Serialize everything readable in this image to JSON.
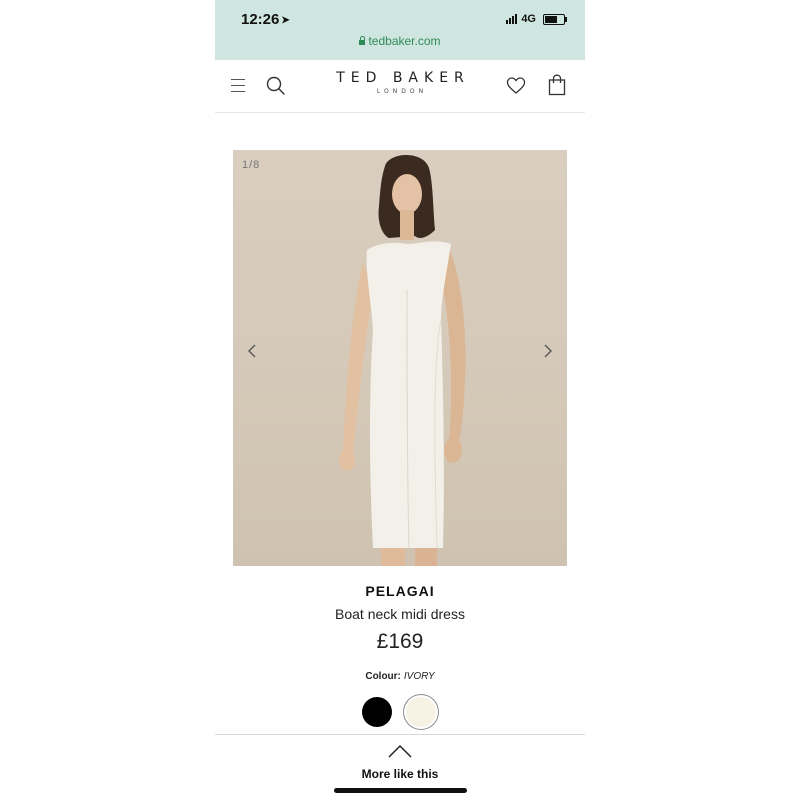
{
  "status_bar": {
    "time": "12:26",
    "network": "4G",
    "icons": [
      "location-arrow-icon",
      "signal-icon",
      "battery-icon"
    ]
  },
  "browser": {
    "url": "tedbaker.com",
    "icons": [
      "lock-icon"
    ]
  },
  "header": {
    "brand": "TED BAKER",
    "brand_sub": "LONDON",
    "icons": [
      "menu-icon",
      "search-icon",
      "heart-icon",
      "shopping-bag-icon"
    ]
  },
  "gallery": {
    "counter": "1/8",
    "icons": [
      "chevron-left-icon",
      "chevron-right-icon"
    ]
  },
  "product": {
    "name": "PELAGAI",
    "description": "Boat neck midi dress",
    "price": "£169",
    "colour_label": "Colour:",
    "colour_value": "IVORY",
    "swatches": [
      {
        "name": "black",
        "hex": "#000000",
        "selected": false
      },
      {
        "name": "ivory",
        "hex": "#f6f3e4",
        "selected": true
      }
    ]
  },
  "more": {
    "label": "More like this",
    "icons": [
      "caret-up-icon"
    ]
  },
  "colors": {
    "browser_bar": "#cfe5e0",
    "url_green": "#2e8b57",
    "image_background": "#d5c9b9"
  }
}
